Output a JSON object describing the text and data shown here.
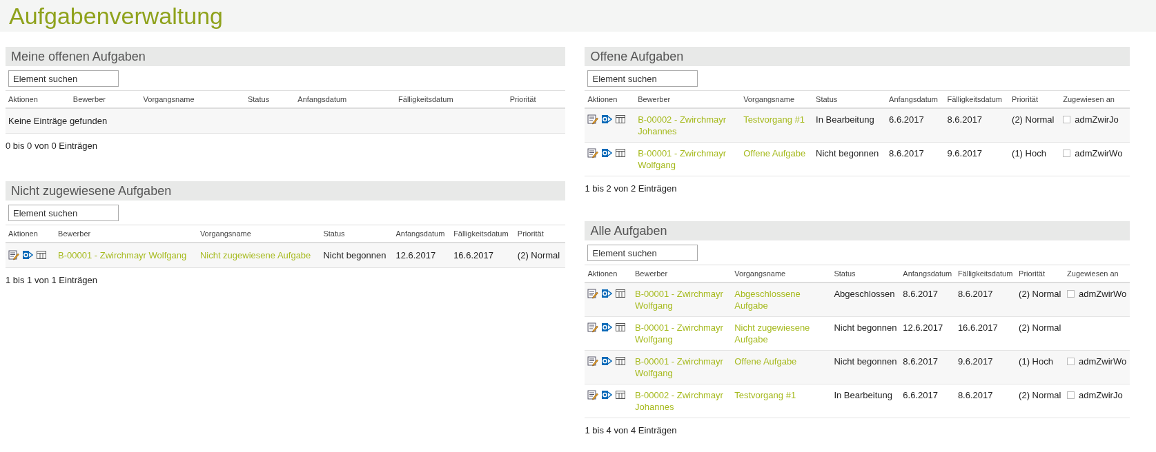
{
  "title": "Aufgabenverwaltung",
  "columns": [
    {
      "panels": [
        {
          "title": "Meine offenen Aufgaben",
          "search": {
            "placeholder": "Element suchen"
          },
          "headers": [
            "Aktionen",
            "Bewerber",
            "Vorgangsname",
            "Status",
            "Anfangsdatum",
            "Fälligkeitsdatum",
            "Priorität"
          ],
          "empty_message": "Keine Einträge gefunden",
          "footer": "0 bis 0 von 0 Einträgen"
        },
        {
          "title": "Nicht zugewiesene Aufgaben",
          "search": {
            "placeholder": "Element suchen"
          },
          "headers": [
            "Aktionen",
            "Bewerber",
            "Vorgangsname",
            "Status",
            "Anfangsdatum",
            "Fälligkeitsdatum",
            "Priorität"
          ],
          "rows": [
            {
              "applicant": "B-00001 - Zwirchmayr Wolfgang",
              "task": "Nicht zugewiesene Aufgabe",
              "status": "Nicht begonnen",
              "start": "12.6.2017",
              "due": "16.6.2017",
              "priority": "(2) Normal"
            }
          ],
          "footer": "1 bis 1 von 1 Einträgen"
        }
      ]
    },
    {
      "panels": [
        {
          "title": "Offene Aufgaben",
          "search": {
            "placeholder": "Element suchen"
          },
          "headers": [
            "Aktionen",
            "Bewerber",
            "Vorgangsname",
            "Status",
            "Anfangsdatum",
            "Fälligkeitsdatum",
            "Priorität",
            "Zugewiesen an"
          ],
          "rows": [
            {
              "applicant": "B-00002 - Zwirchmayr Johannes",
              "task": "Testvorgang #1",
              "status": "In Bearbeitung",
              "start": "6.6.2017",
              "due": "8.6.2017",
              "priority": "(2) Normal",
              "assignee": {
                "name": "admZwirJo",
                "checked": false
              }
            },
            {
              "applicant": "B-00001 - Zwirchmayr Wolfgang",
              "task": "Offene Aufgabe",
              "status": "Nicht begonnen",
              "start": "8.6.2017",
              "due": "9.6.2017",
              "priority": "(1) Hoch",
              "assignee": {
                "name": "admZwirWo",
                "checked": false
              }
            }
          ],
          "footer": "1 bis 2 von 2 Einträgen"
        },
        {
          "title": "Alle Aufgaben",
          "search": {
            "placeholder": "Element suchen"
          },
          "headers": [
            "Aktionen",
            "Bewerber",
            "Vorgangsname",
            "Status",
            "Anfangsdatum",
            "Fälligkeitsdatum",
            "Priorität",
            "Zugewiesen an"
          ],
          "rows": [
            {
              "applicant": "B-00001 - Zwirchmayr Wolfgang",
              "task": "Abgeschlossene Aufgabe",
              "status": "Abgeschlossen",
              "start": "8.6.2017",
              "due": "8.6.2017",
              "priority": "(2) Normal",
              "assignee": {
                "name": "admZwirWo",
                "checked": false
              }
            },
            {
              "applicant": "B-00001 - Zwirchmayr Wolfgang",
              "task": "Nicht zugewiesene Aufgabe",
              "status": "Nicht begonnen",
              "start": "12.6.2017",
              "due": "16.6.2017",
              "priority": "(2) Normal"
            },
            {
              "applicant": "B-00001 - Zwirchmayr Wolfgang",
              "task": "Offene Aufgabe",
              "status": "Nicht begonnen",
              "start": "8.6.2017",
              "due": "9.6.2017",
              "priority": "(1) Hoch",
              "assignee": {
                "name": "admZwirWo",
                "checked": false
              }
            },
            {
              "applicant": "B-00002 - Zwirchmayr Johannes",
              "task": "Testvorgang #1",
              "status": "In Bearbeitung",
              "start": "6.6.2017",
              "due": "8.6.2017",
              "priority": "(2) Normal",
              "assignee": {
                "name": "admZwirJo",
                "checked": false
              }
            }
          ],
          "footer": "1 bis 4 von 4 Einträgen"
        }
      ]
    }
  ]
}
